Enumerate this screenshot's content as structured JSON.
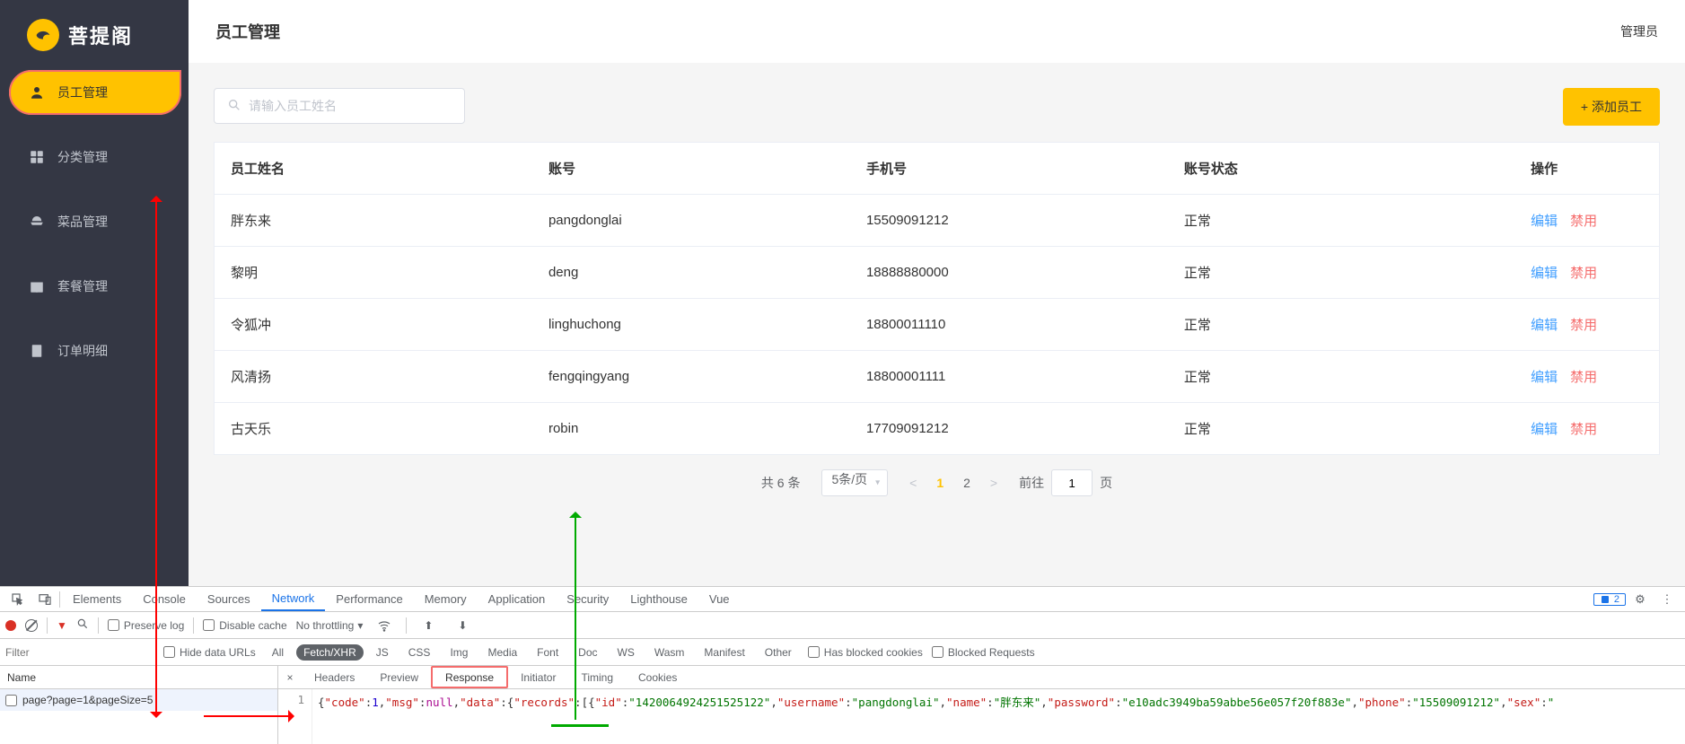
{
  "logo": {
    "text": "菩提阁"
  },
  "header": {
    "title": "员工管理",
    "right": "管理员"
  },
  "sidebar": {
    "items": [
      {
        "label": "员工管理",
        "icon": "user"
      },
      {
        "label": "分类管理",
        "icon": "grid"
      },
      {
        "label": "菜品管理",
        "icon": "dish"
      },
      {
        "label": "套餐管理",
        "icon": "gift"
      },
      {
        "label": "订单明细",
        "icon": "doc"
      }
    ]
  },
  "toolbar": {
    "search_placeholder": "请输入员工姓名",
    "add_label": "+ 添加员工"
  },
  "table": {
    "columns": {
      "name": "员工姓名",
      "account": "账号",
      "phone": "手机号",
      "status": "账号状态",
      "action": "操作"
    },
    "action_edit": "编辑",
    "action_disable": "禁用",
    "rows": [
      {
        "name": "胖东来",
        "account": "pangdonglai",
        "phone": "15509091212",
        "status": "正常"
      },
      {
        "name": "黎明",
        "account": "deng",
        "phone": "18888880000",
        "status": "正常"
      },
      {
        "name": "令狐冲",
        "account": "linghuchong",
        "phone": "18800011110",
        "status": "正常"
      },
      {
        "name": "风清扬",
        "account": "fengqingyang",
        "phone": "18800001111",
        "status": "正常"
      },
      {
        "name": "古天乐",
        "account": "robin",
        "phone": "17709091212",
        "status": "正常"
      }
    ]
  },
  "pagination": {
    "total": "共 6 条",
    "page_size": "5条/页",
    "pages": [
      "1",
      "2"
    ],
    "jump_prefix": "前往",
    "jump_value": "1",
    "jump_suffix": "页"
  },
  "devtools": {
    "tabs": [
      "Elements",
      "Console",
      "Sources",
      "Network",
      "Performance",
      "Memory",
      "Application",
      "Security",
      "Lighthouse",
      "Vue"
    ],
    "active_tab": "Network",
    "msg_count": "2",
    "row2": {
      "preserve_log": "Preserve log",
      "disable_cache": "Disable cache",
      "throttling": "No throttling"
    },
    "row3": {
      "filter_placeholder": "Filter",
      "hide_data": "Hide data URLs",
      "types": [
        "All",
        "Fetch/XHR",
        "JS",
        "CSS",
        "Img",
        "Media",
        "Font",
        "Doc",
        "WS",
        "Wasm",
        "Manifest",
        "Other"
      ],
      "active_type": "Fetch/XHR",
      "blocked_cookies": "Has blocked cookies",
      "blocked_req": "Blocked Requests"
    },
    "name_header": "Name",
    "request": "page?page=1&pageSize=5",
    "detail_tabs": [
      "Headers",
      "Preview",
      "Response",
      "Initiator",
      "Timing",
      "Cookies"
    ],
    "active_detail": "Response",
    "lineno": "1",
    "response": {
      "code": 1,
      "msg_label": "msg",
      "data_label": "data",
      "records_label": "records",
      "record": {
        "id": "1420064924251525122",
        "username": "pangdonglai",
        "name": "胖东来",
        "password": "e10adc3949ba59abbe56e057f20f883e",
        "phone": "15509091212",
        "sex_key": "sex"
      }
    }
  }
}
